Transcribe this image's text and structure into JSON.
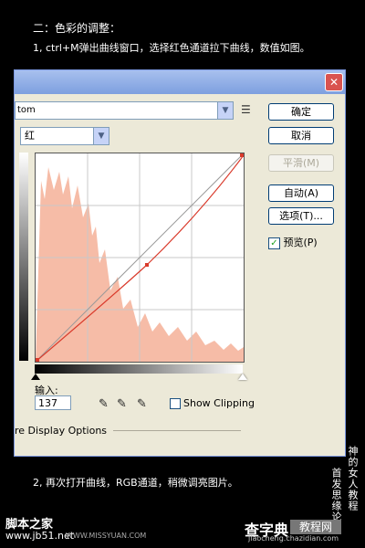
{
  "tutorial": {
    "heading": "二：色彩的调整：",
    "step1": "1, ctrl+M弹出曲线窗口，选择红色通道拉下曲线，数值如图。",
    "step2": "2, 再次打开曲线，RGB通道，稍微调亮图片。"
  },
  "dialog": {
    "preset_value": "tom",
    "channel_value": "红",
    "buttons": {
      "ok": "确定",
      "cancel": "取消",
      "smooth": "平滑(M)",
      "auto": "自动(A)",
      "options": "选项(T)..."
    },
    "preview_label": "预览(P)",
    "input_label": "输入:",
    "input_value": "137",
    "show_clipping": "Show Clipping",
    "display_options": "re Display Options",
    "icons": {
      "close": "close-icon",
      "preset_menu": "preset-menu-icon",
      "black_dropper": "eyedropper-black-icon",
      "gray_dropper": "eyedropper-gray-icon",
      "white_dropper": "eyedropper-white-icon"
    }
  },
  "watermarks": {
    "vertical1": "神的女人教程",
    "vertical2": "首发思缘论坛",
    "left1": "脚本之家",
    "left2": "www.jb51.net",
    "left_overlay": "WWW.MISSYUAN.COM",
    "right1": "查字典",
    "right_badge": "教程网",
    "right2": "jiaocheng.chazidian.com"
  },
  "colors": {
    "curve": "#d93a2b",
    "histogram": "#f6bca7"
  }
}
